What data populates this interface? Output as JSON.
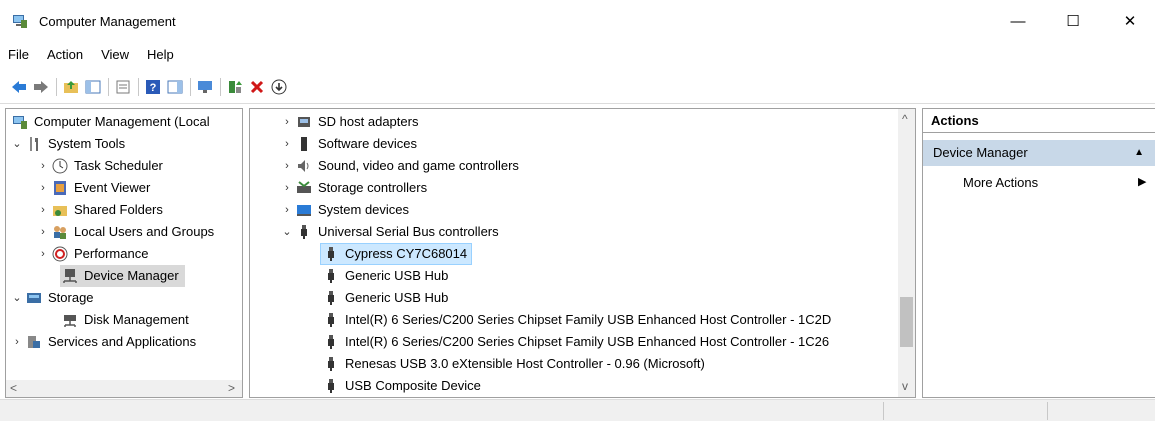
{
  "window": {
    "title": "Computer Management"
  },
  "controls": {
    "minimize": "—",
    "maximize": "☐",
    "close": "✕"
  },
  "menu": [
    "File",
    "Action",
    "View",
    "Help"
  ],
  "left_tree": [
    {
      "label": "Computer Management (Local",
      "chev": "",
      "icon": "computer-mgmt-icon"
    },
    {
      "label": "System Tools",
      "chev": "⌄",
      "icon": "tools-icon"
    },
    {
      "label": "Task Scheduler",
      "chev": "›",
      "icon": "clock-icon"
    },
    {
      "label": "Event Viewer",
      "chev": "›",
      "icon": "event-viewer-icon"
    },
    {
      "label": "Shared Folders",
      "chev": "›",
      "icon": "shared-folder-icon"
    },
    {
      "label": "Local Users and Groups",
      "chev": "›",
      "icon": "users-icon"
    },
    {
      "label": "Performance",
      "chev": "›",
      "icon": "performance-icon"
    },
    {
      "label": "Device Manager",
      "chev": "",
      "icon": "device-manager-icon"
    },
    {
      "label": "Storage",
      "chev": "⌄",
      "icon": "storage-icon"
    },
    {
      "label": "Disk Management",
      "chev": "",
      "icon": "disk-icon"
    },
    {
      "label": "Services and Applications",
      "chev": "›",
      "icon": "services-icon"
    }
  ],
  "device_tree": [
    {
      "label": "SD host adapters",
      "chev": "›",
      "icon": "sd-adapter-icon"
    },
    {
      "label": "Software devices",
      "chev": "›",
      "icon": "software-device-icon"
    },
    {
      "label": "Sound, video and game controllers",
      "chev": "›",
      "icon": "speaker-icon"
    },
    {
      "label": "Storage controllers",
      "chev": "›",
      "icon": "storage-controller-icon"
    },
    {
      "label": "System devices",
      "chev": "›",
      "icon": "system-device-icon"
    },
    {
      "label": "Universal Serial Bus controllers",
      "chev": "⌄",
      "icon": "usb-icon"
    },
    {
      "label": "Cypress CY7C68014",
      "chev": "",
      "icon": "usb-icon"
    },
    {
      "label": "Generic USB Hub",
      "chev": "",
      "icon": "usb-icon"
    },
    {
      "label": "Generic USB Hub",
      "chev": "",
      "icon": "usb-icon"
    },
    {
      "label": "Intel(R) 6 Series/C200 Series Chipset Family USB Enhanced Host Controller - 1C2D",
      "chev": "",
      "icon": "usb-icon"
    },
    {
      "label": "Intel(R) 6 Series/C200 Series Chipset Family USB Enhanced Host Controller - 1C26",
      "chev": "",
      "icon": "usb-icon"
    },
    {
      "label": "Renesas USB 3.0 eXtensible Host Controller - 0.96 (Microsoft)",
      "chev": "",
      "icon": "usb-icon"
    },
    {
      "label": "USB Composite Device",
      "chev": "",
      "icon": "usb-icon"
    }
  ],
  "actions": {
    "header": "Actions",
    "section": "Device Manager",
    "item": "More Actions"
  }
}
